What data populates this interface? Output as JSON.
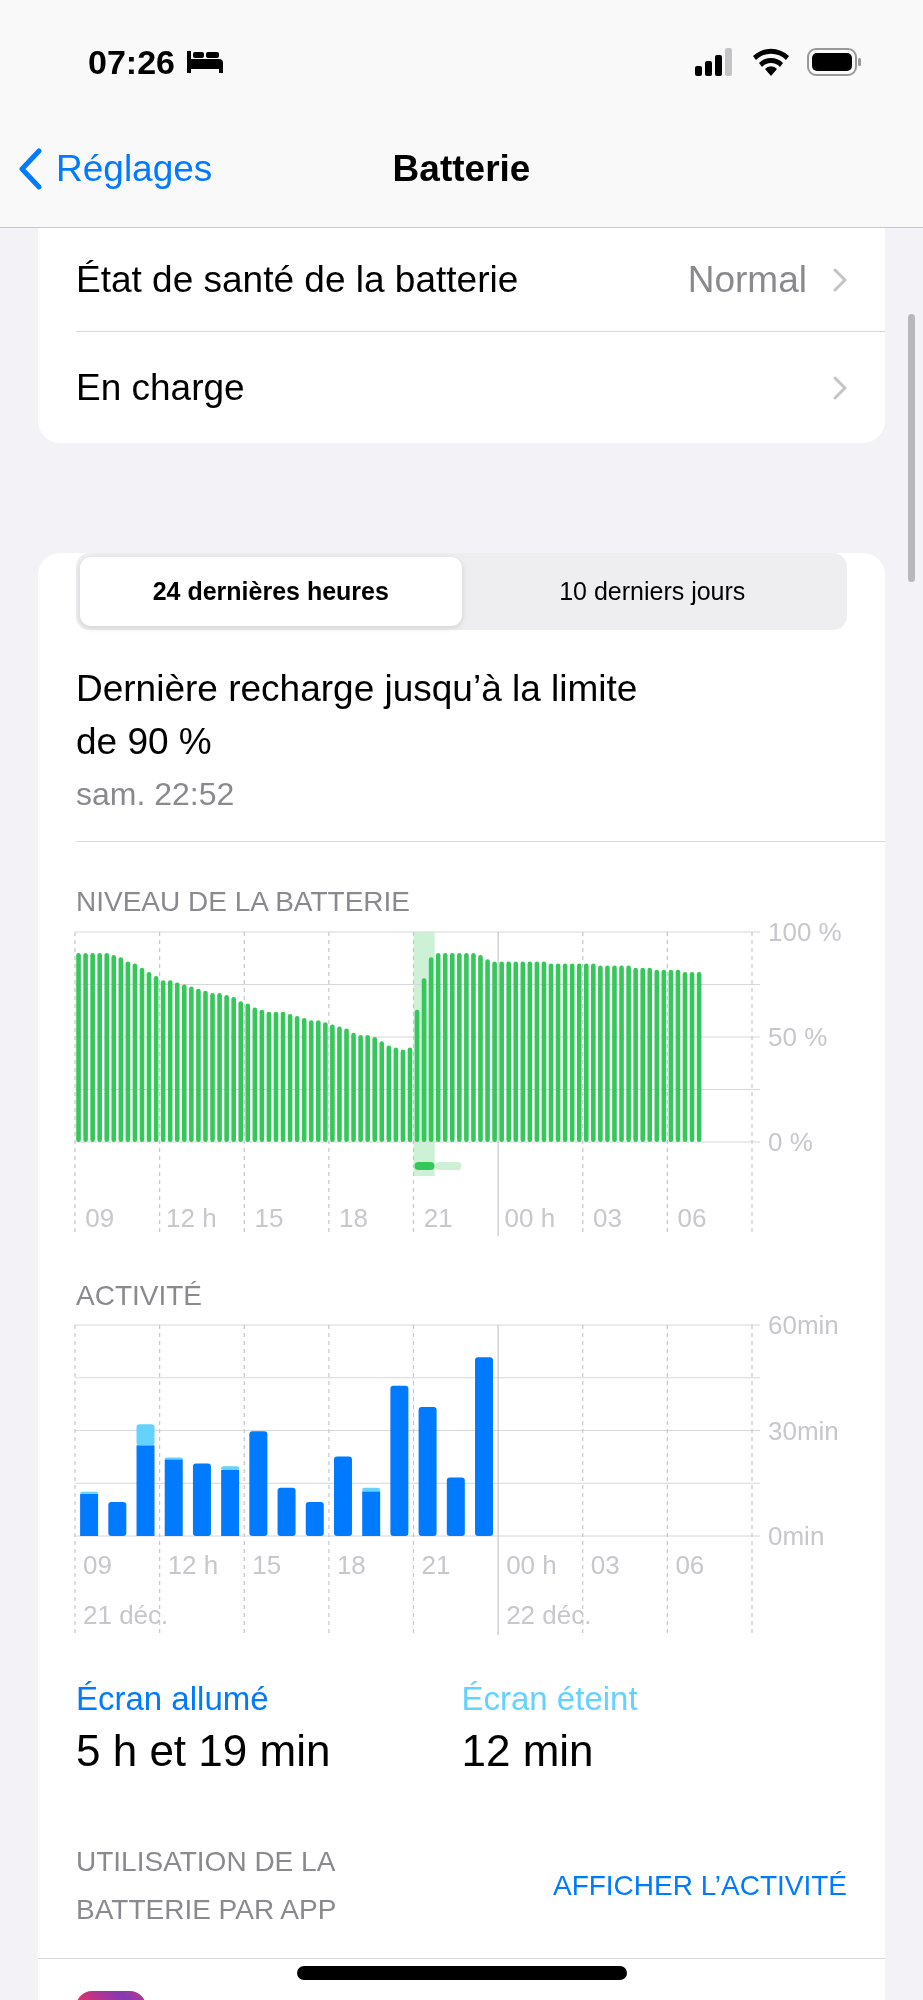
{
  "status_bar": {
    "time": "07:26"
  },
  "nav": {
    "back": "Réglages",
    "title": "Batterie"
  },
  "settings_rows": [
    {
      "label": "État de santé de la batterie",
      "value": "Normal"
    },
    {
      "label": "En charge"
    }
  ],
  "tabs": [
    {
      "label": "24 dernières heures",
      "selected": true
    },
    {
      "label": "10 derniers jours",
      "selected": false
    }
  ],
  "last_charge": {
    "title": "Dernière recharge jusqu’à la limite de 90 %",
    "time": "sam. 22:52"
  },
  "battery_level": {
    "heading": "NIVEAU DE LA BATTERIE",
    "chart_data": {
      "type": "bar",
      "ylim": [
        0,
        100
      ],
      "yticks": [
        {
          "value": 0,
          "label": "0 %"
        },
        {
          "value": 50,
          "label": "50 %"
        },
        {
          "value": 100,
          "label": "100 %"
        }
      ],
      "grid": true,
      "categories": [
        null,
        null,
        null,
        "09",
        null,
        null,
        null,
        null,
        null,
        null,
        null,
        null,
        null,
        null,
        null,
        null,
        "12 h",
        null,
        null,
        null,
        null,
        null,
        null,
        null,
        null,
        null,
        null,
        "15",
        null,
        null,
        null,
        null,
        null,
        null,
        null,
        null,
        null,
        null,
        null,
        "18",
        null,
        null,
        null,
        null,
        null,
        null,
        null,
        null,
        null,
        null,
        null,
        "21",
        null,
        null,
        null,
        null,
        null,
        null,
        null,
        null,
        null,
        null,
        null,
        null,
        "00 h",
        null,
        null,
        null,
        null,
        null,
        null,
        null,
        null,
        null,
        null,
        "03",
        null,
        null,
        null,
        null,
        null,
        null,
        null,
        null,
        null,
        null,
        null,
        "06",
        null,
        null,
        null,
        null,
        null,
        null,
        null,
        null
      ],
      "series": [
        {
          "color": "#34c759",
          "values": [
            90,
            90,
            90,
            90,
            90,
            89,
            88,
            86,
            85,
            83,
            81,
            79,
            77,
            77,
            76,
            75,
            74,
            73,
            72,
            71,
            71,
            70,
            69,
            67,
            66,
            64,
            63,
            62,
            62,
            62,
            61,
            60,
            59,
            58,
            58,
            57,
            56,
            55,
            54,
            52,
            51,
            51,
            50,
            48,
            46,
            45,
            44,
            45,
            63,
            78,
            88,
            90,
            90,
            90,
            90,
            90,
            90,
            89,
            87,
            86,
            86,
            86,
            86,
            86,
            86,
            86,
            86,
            85,
            85,
            85,
            85,
            85,
            85,
            85,
            84,
            84,
            84,
            84,
            84,
            83,
            83,
            83,
            82,
            82,
            82,
            82,
            81,
            81,
            81,
            null,
            null,
            null,
            null,
            null,
            null,
            null
          ]
        }
      ]
    }
  },
  "activity": {
    "heading": "ACTIVITÉ",
    "chart_data": {
      "type": "bar",
      "stacked": true,
      "ylim": [
        0,
        60
      ],
      "yticks": [
        {
          "value": 0,
          "label": "0min"
        },
        {
          "value": 30,
          "label": "30min"
        },
        {
          "value": 60,
          "label": "60min"
        }
      ],
      "grid": true,
      "categories": [
        "09",
        null,
        null,
        "12 h",
        null,
        null,
        "15",
        null,
        null,
        "18",
        null,
        null,
        "21",
        null,
        null,
        "00 h",
        null,
        null,
        "03",
        null,
        null,
        "06",
        null,
        null
      ],
      "series": [
        {
          "name": "Écran allumé",
          "color": "#007aff",
          "values": [
            12,
            9.7,
            25.8,
            21.8,
            20.6,
            18.8,
            29.8,
            13.7,
            9.7,
            22.6,
            12.7,
            42.7,
            36.7,
            16.6,
            50.8,
            null,
            null,
            null,
            null,
            null,
            null,
            null,
            null,
            null
          ]
        },
        {
          "name": "Écran éteint",
          "color": "#64d2ff",
          "values": [
            0.6,
            0,
            6,
            0.5,
            0,
            1,
            0,
            0,
            0,
            0,
            1,
            0,
            0,
            0,
            0,
            null,
            null,
            null,
            null,
            null,
            null,
            null,
            null,
            null
          ]
        }
      ]
    },
    "dates": [
      "21 déc.",
      "22 déc."
    ]
  },
  "legend": [
    {
      "value": "5 h et 19 min"
    },
    {
      "value": "12 min"
    }
  ],
  "app_usage": {
    "heading": "UTILISATION DE LA BATTERIE PAR APP",
    "link": "AFFICHER L’ACTIVITÉ"
  }
}
